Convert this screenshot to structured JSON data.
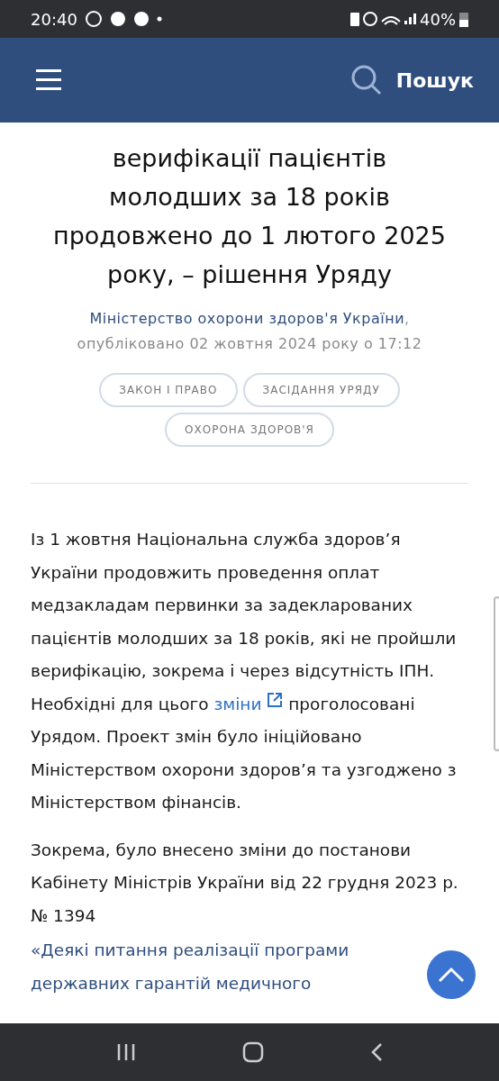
{
  "status_bar": {
    "time": "20:40",
    "battery": "40%"
  },
  "header": {
    "search_label": "Пошук"
  },
  "article": {
    "title_lines": [
      "верифікації пацієнтів",
      "молодших за 18 років",
      "продовжено до 1 лютого 2025",
      "року, – рішення Уряду"
    ],
    "author": "Міністерство охорони здоров'я України",
    "author_separator": ",",
    "published": "опубліковано 02 жовтня 2024 року о 17:12",
    "tags": [
      {
        "label": "ЗАКОН І ПРАВО"
      },
      {
        "label": "ЗАСІДАННЯ УРЯДУ"
      },
      {
        "label": "ОХОРОНА ЗДОРОВ'Я"
      }
    ],
    "paragraphs": [
      {
        "before": "Із 1 жовтня Національна служба здоров’я України продовжить проведення оплат медзакладам первинки за задекларованих пацієнтів молодших за 18 років, які не пройшли верифікацію, зокрема і через відсутність ІПН. Необхідні для цього",
        "link": "зміни",
        "after": "проголосовані Урядом. Проект змін було ініційовано Міністерством охорони здоров’я та узгоджено з Міністерством фінансів."
      },
      {
        "before": "Зокрема, було внесено зміни до постанови Кабінету Міністрів України від 22 грудня 2023 р. № 1394"
      }
    ],
    "link_paragraph": "«Деякі питання реалізації програми державних гарантій медичного"
  }
}
